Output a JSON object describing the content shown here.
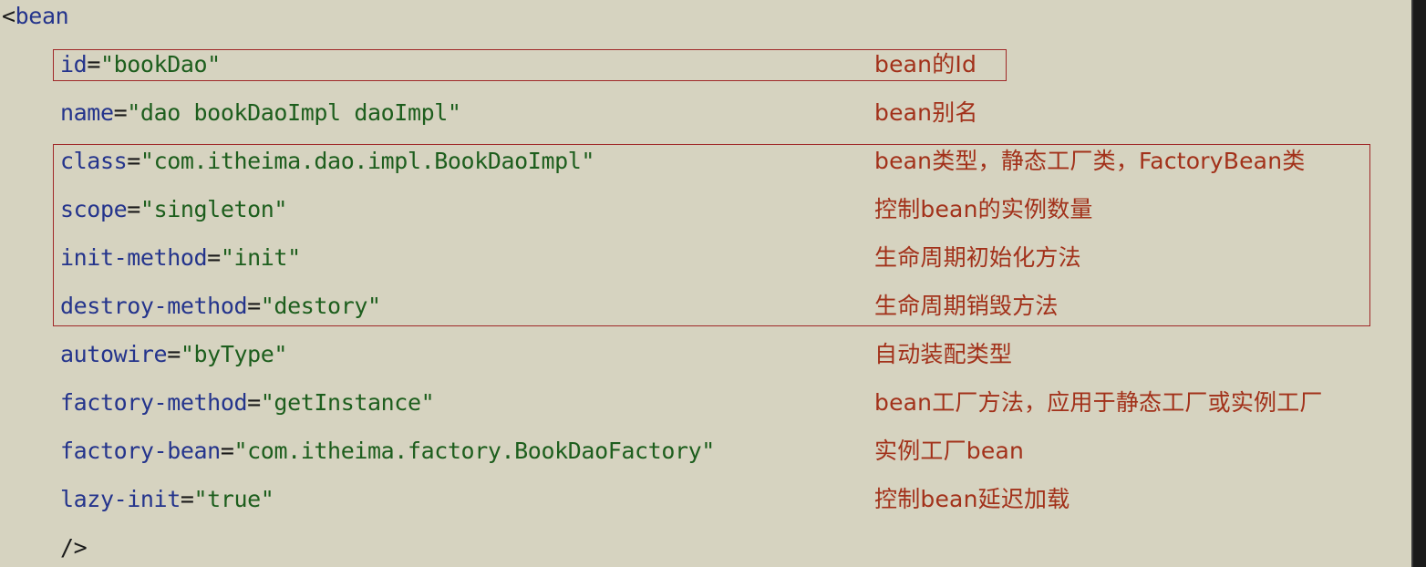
{
  "open_tag": {
    "lt": "<",
    "name": "bean"
  },
  "attributes": [
    {
      "name": "id",
      "eq": "=",
      "value": "\"bookDao\"",
      "comment": "bean的Id"
    },
    {
      "name": "name",
      "eq": "=",
      "value": "\"dao bookDaoImpl daoImpl\"",
      "comment": "bean别名"
    },
    {
      "name": "class",
      "eq": "=",
      "value": "\"com.itheima.dao.impl.BookDaoImpl\"",
      "comment": "bean类型，静态工厂类，FactoryBean类"
    },
    {
      "name": "scope",
      "eq": "=",
      "value": "\"singleton\"",
      "comment": "控制bean的实例数量"
    },
    {
      "name": "init-method",
      "eq": "=",
      "value": "\"init\"",
      "comment": "生命周期初始化方法"
    },
    {
      "name": "destroy-method",
      "eq": "=",
      "value": "\"destory\"",
      "comment": "生命周期销毁方法"
    },
    {
      "name": "autowire",
      "eq": "=",
      "value": "\"byType\"",
      "comment": "自动装配类型"
    },
    {
      "name": "factory-method",
      "eq": "=",
      "value": "\"getInstance\"",
      "comment": "bean工厂方法，应用于静态工厂或实例工厂"
    },
    {
      "name": "factory-bean",
      "eq": "=",
      "value": "\"com.itheima.factory.BookDaoFactory\"",
      "comment": "实例工厂bean"
    },
    {
      "name": "lazy-init",
      "eq": "=",
      "value": "\"true\"",
      "comment": "控制bean延迟加载"
    }
  ],
  "close_tag": "/>",
  "colors": {
    "background": "#d6d3c0",
    "tag": "#24348c",
    "value": "#1d5e1d",
    "comment": "#a2311a",
    "highlight_box": "#a02828"
  }
}
